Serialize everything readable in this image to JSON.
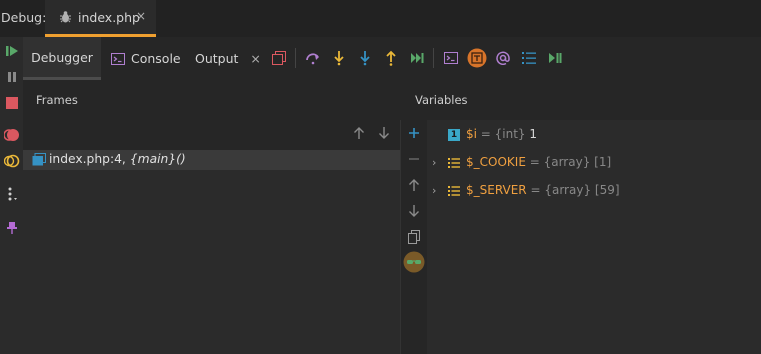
{
  "top_bar": {
    "label": "Debug:",
    "tab_file": "index.php",
    "tab_close": "×"
  },
  "toolbar": {
    "tab_debugger": "Debugger",
    "tab_console": "Console",
    "tab_output": "Output",
    "output_close": "×"
  },
  "frames": {
    "title": "Frames",
    "items": [
      {
        "location": "index.php:4,",
        "function": "{main}()"
      }
    ]
  },
  "variables": {
    "title": "Variables",
    "items": [
      {
        "name": "$i",
        "eq": " = ",
        "type": "{int}",
        "value": " 1",
        "icon": "int-badge",
        "badge": "1",
        "expandable": false
      },
      {
        "name": "$_COOKIE",
        "eq": " = ",
        "type": "{array}",
        "value": " [1]",
        "icon": "array-icon",
        "badge": "",
        "expandable": true
      },
      {
        "name": "$_SERVER",
        "eq": " = ",
        "type": "{array}",
        "value": " [59]",
        "icon": "array-icon",
        "badge": "",
        "expandable": true
      }
    ]
  },
  "colors": {
    "accent_tab": "#f0a030",
    "variable_name": "#f0a040",
    "resume_green": "#59a869",
    "stop_red": "#db5860",
    "step_blue": "#3592c4",
    "step_yellow": "#eab839"
  }
}
